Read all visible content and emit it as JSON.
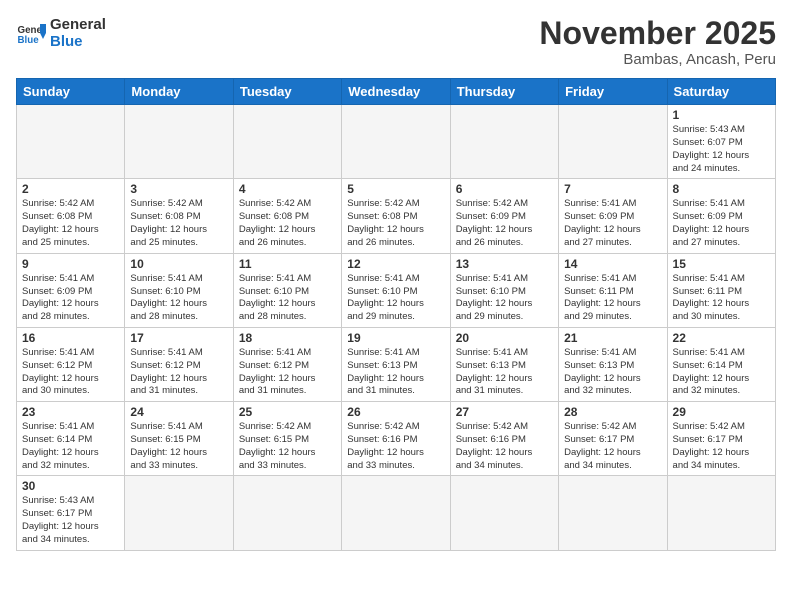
{
  "header": {
    "logo_general": "General",
    "logo_blue": "Blue",
    "month_title": "November 2025",
    "location": "Bambas, Ancash, Peru"
  },
  "weekdays": [
    "Sunday",
    "Monday",
    "Tuesday",
    "Wednesday",
    "Thursday",
    "Friday",
    "Saturday"
  ],
  "weeks": [
    [
      {
        "day": "",
        "info": ""
      },
      {
        "day": "",
        "info": ""
      },
      {
        "day": "",
        "info": ""
      },
      {
        "day": "",
        "info": ""
      },
      {
        "day": "",
        "info": ""
      },
      {
        "day": "",
        "info": ""
      },
      {
        "day": "1",
        "info": "Sunrise: 5:43 AM\nSunset: 6:07 PM\nDaylight: 12 hours\nand 24 minutes."
      }
    ],
    [
      {
        "day": "2",
        "info": "Sunrise: 5:42 AM\nSunset: 6:08 PM\nDaylight: 12 hours\nand 25 minutes."
      },
      {
        "day": "3",
        "info": "Sunrise: 5:42 AM\nSunset: 6:08 PM\nDaylight: 12 hours\nand 25 minutes."
      },
      {
        "day": "4",
        "info": "Sunrise: 5:42 AM\nSunset: 6:08 PM\nDaylight: 12 hours\nand 26 minutes."
      },
      {
        "day": "5",
        "info": "Sunrise: 5:42 AM\nSunset: 6:08 PM\nDaylight: 12 hours\nand 26 minutes."
      },
      {
        "day": "6",
        "info": "Sunrise: 5:42 AM\nSunset: 6:09 PM\nDaylight: 12 hours\nand 26 minutes."
      },
      {
        "day": "7",
        "info": "Sunrise: 5:41 AM\nSunset: 6:09 PM\nDaylight: 12 hours\nand 27 minutes."
      },
      {
        "day": "8",
        "info": "Sunrise: 5:41 AM\nSunset: 6:09 PM\nDaylight: 12 hours\nand 27 minutes."
      }
    ],
    [
      {
        "day": "9",
        "info": "Sunrise: 5:41 AM\nSunset: 6:09 PM\nDaylight: 12 hours\nand 28 minutes."
      },
      {
        "day": "10",
        "info": "Sunrise: 5:41 AM\nSunset: 6:10 PM\nDaylight: 12 hours\nand 28 minutes."
      },
      {
        "day": "11",
        "info": "Sunrise: 5:41 AM\nSunset: 6:10 PM\nDaylight: 12 hours\nand 28 minutes."
      },
      {
        "day": "12",
        "info": "Sunrise: 5:41 AM\nSunset: 6:10 PM\nDaylight: 12 hours\nand 29 minutes."
      },
      {
        "day": "13",
        "info": "Sunrise: 5:41 AM\nSunset: 6:10 PM\nDaylight: 12 hours\nand 29 minutes."
      },
      {
        "day": "14",
        "info": "Sunrise: 5:41 AM\nSunset: 6:11 PM\nDaylight: 12 hours\nand 29 minutes."
      },
      {
        "day": "15",
        "info": "Sunrise: 5:41 AM\nSunset: 6:11 PM\nDaylight: 12 hours\nand 30 minutes."
      }
    ],
    [
      {
        "day": "16",
        "info": "Sunrise: 5:41 AM\nSunset: 6:12 PM\nDaylight: 12 hours\nand 30 minutes."
      },
      {
        "day": "17",
        "info": "Sunrise: 5:41 AM\nSunset: 6:12 PM\nDaylight: 12 hours\nand 31 minutes."
      },
      {
        "day": "18",
        "info": "Sunrise: 5:41 AM\nSunset: 6:12 PM\nDaylight: 12 hours\nand 31 minutes."
      },
      {
        "day": "19",
        "info": "Sunrise: 5:41 AM\nSunset: 6:13 PM\nDaylight: 12 hours\nand 31 minutes."
      },
      {
        "day": "20",
        "info": "Sunrise: 5:41 AM\nSunset: 6:13 PM\nDaylight: 12 hours\nand 31 minutes."
      },
      {
        "day": "21",
        "info": "Sunrise: 5:41 AM\nSunset: 6:13 PM\nDaylight: 12 hours\nand 32 minutes."
      },
      {
        "day": "22",
        "info": "Sunrise: 5:41 AM\nSunset: 6:14 PM\nDaylight: 12 hours\nand 32 minutes."
      }
    ],
    [
      {
        "day": "23",
        "info": "Sunrise: 5:41 AM\nSunset: 6:14 PM\nDaylight: 12 hours\nand 32 minutes."
      },
      {
        "day": "24",
        "info": "Sunrise: 5:41 AM\nSunset: 6:15 PM\nDaylight: 12 hours\nand 33 minutes."
      },
      {
        "day": "25",
        "info": "Sunrise: 5:42 AM\nSunset: 6:15 PM\nDaylight: 12 hours\nand 33 minutes."
      },
      {
        "day": "26",
        "info": "Sunrise: 5:42 AM\nSunset: 6:16 PM\nDaylight: 12 hours\nand 33 minutes."
      },
      {
        "day": "27",
        "info": "Sunrise: 5:42 AM\nSunset: 6:16 PM\nDaylight: 12 hours\nand 34 minutes."
      },
      {
        "day": "28",
        "info": "Sunrise: 5:42 AM\nSunset: 6:17 PM\nDaylight: 12 hours\nand 34 minutes."
      },
      {
        "day": "29",
        "info": "Sunrise: 5:42 AM\nSunset: 6:17 PM\nDaylight: 12 hours\nand 34 minutes."
      }
    ],
    [
      {
        "day": "30",
        "info": "Sunrise: 5:43 AM\nSunset: 6:17 PM\nDaylight: 12 hours\nand 34 minutes."
      },
      {
        "day": "",
        "info": ""
      },
      {
        "day": "",
        "info": ""
      },
      {
        "day": "",
        "info": ""
      },
      {
        "day": "",
        "info": ""
      },
      {
        "day": "",
        "info": ""
      },
      {
        "day": "",
        "info": ""
      }
    ]
  ]
}
